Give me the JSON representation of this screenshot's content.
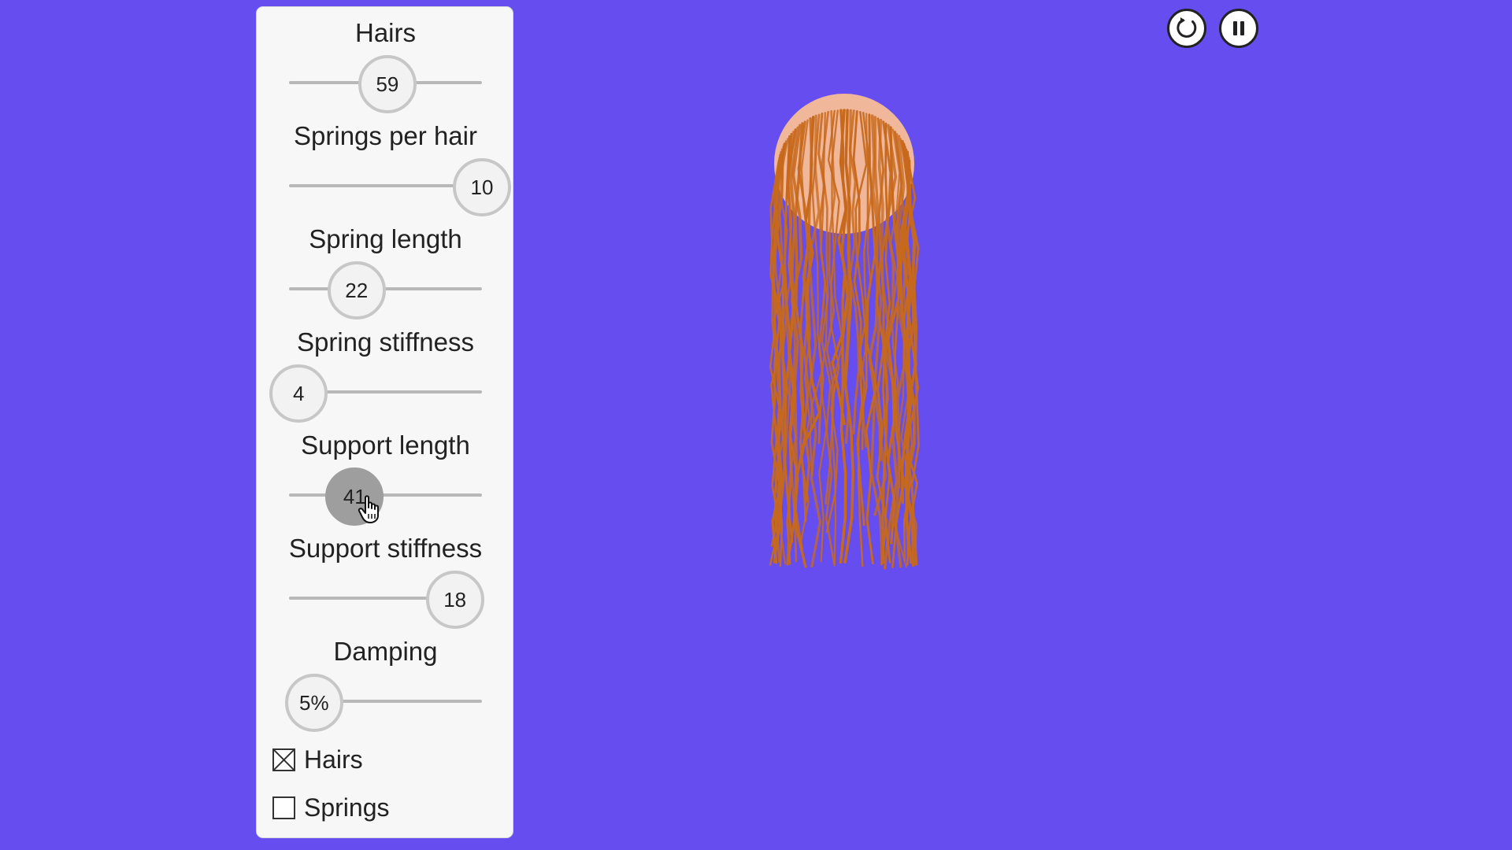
{
  "app": {
    "background_color": "#654df0",
    "panel_color": "#f7f7f7",
    "hair_color": "#c7691c",
    "head_color": "#f0b79b"
  },
  "controls": [
    {
      "label": "Hairs",
      "value_text": "59",
      "position": 0.51
    },
    {
      "label": "Springs per hair",
      "value_text": "10",
      "position": 1.0
    },
    {
      "label": "Spring length",
      "value_text": "22",
      "position": 0.35
    },
    {
      "label": "Spring stiffness",
      "value_text": "4",
      "position": 0.05
    },
    {
      "label": "Support length",
      "value_text": "41",
      "position": 0.34,
      "active": true
    },
    {
      "label": "Support stiffness",
      "value_text": "18",
      "position": 0.86
    },
    {
      "label": "Damping",
      "value_text": "5%",
      "position": 0.13
    }
  ],
  "checkboxes": [
    {
      "label": "Hairs",
      "checked": true
    },
    {
      "label": "Springs",
      "checked": false
    }
  ],
  "toolbar": {
    "reset_icon": "reload-icon",
    "pause_icon": "pause-icon"
  }
}
